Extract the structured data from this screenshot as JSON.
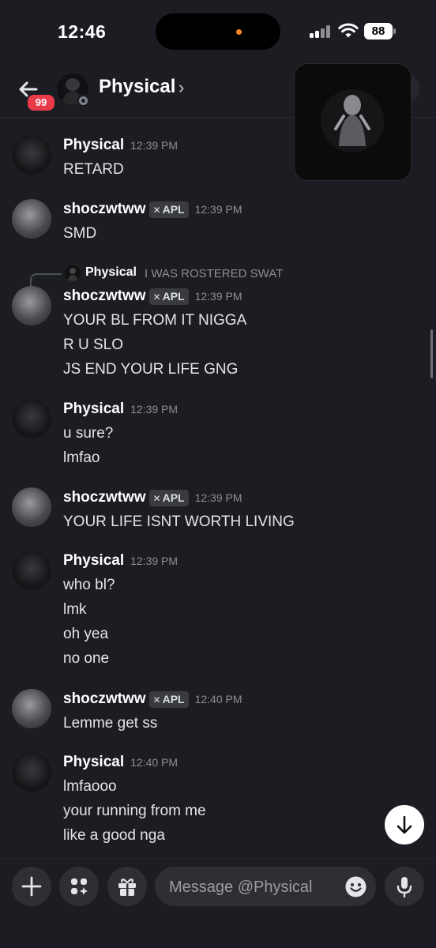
{
  "status_bar": {
    "time": "12:46",
    "battery": "88"
  },
  "header": {
    "badge": "99",
    "title": "Physical",
    "chevron": "›"
  },
  "reply": {
    "author": "Physical",
    "text": "I WAS ROSTERED SWAT"
  },
  "messages": [
    {
      "author": "Physical",
      "tag": "",
      "time": "12:39 PM",
      "lines": [
        "RETARD"
      ]
    },
    {
      "author": "shoczwtww",
      "tag": "APL",
      "time": "12:39 PM",
      "lines": [
        "SMD"
      ]
    },
    {
      "author": "shoczwtww",
      "tag": "APL",
      "time": "12:39 PM",
      "lines": [
        "YOUR BL FROM IT NIGGA",
        "R U SLO",
        "JS END YOUR LIFE GNG"
      ]
    },
    {
      "author": "Physical",
      "tag": "",
      "time": "12:39 PM",
      "lines": [
        "u sure?",
        "lmfao"
      ]
    },
    {
      "author": "shoczwtww",
      "tag": "APL",
      "time": "12:39 PM",
      "lines": [
        "YOUR LIFE ISNT WORTH LIVING"
      ]
    },
    {
      "author": "Physical",
      "tag": "",
      "time": "12:39 PM",
      "lines": [
        "who bl?",
        "lmk",
        "oh yea",
        "no one"
      ]
    },
    {
      "author": "shoczwtww",
      "tag": "APL",
      "time": "12:40 PM",
      "lines": [
        "Lemme get ss"
      ]
    },
    {
      "author": "Physical",
      "tag": "",
      "time": "12:40 PM",
      "lines": [
        "lmfaooo",
        "your running from me",
        "like a good nga"
      ]
    }
  ],
  "composer": {
    "placeholder": "Message @Physical"
  },
  "icons": {
    "back": "arrow-left-icon",
    "add": "plus-icon",
    "apps": "apps-sparkle-icon",
    "gift": "gift-icon",
    "emoji": "emoji-icon",
    "mic": "microphone-icon",
    "scroll": "arrow-down-icon"
  },
  "colors": {
    "background": "#1c1d22",
    "badge": "#e93a47",
    "tag": "#3a3b41",
    "timestamp": "#8c8e94"
  }
}
